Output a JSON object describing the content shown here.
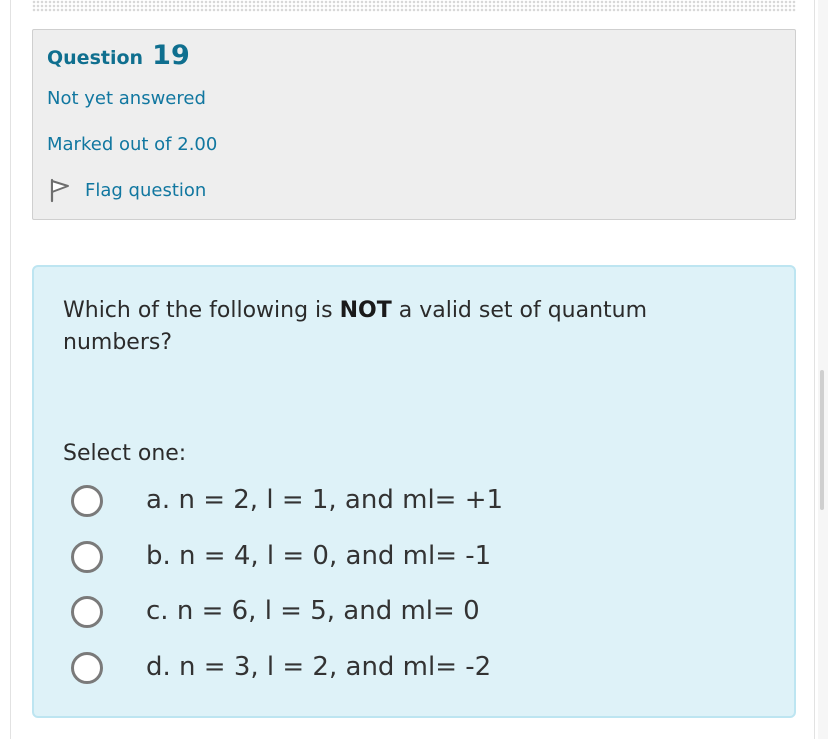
{
  "info": {
    "question_label": "Question",
    "question_number": "19",
    "state": "Not yet answered",
    "grade": "Marked out of 2.00",
    "flag_label": "Flag question",
    "flag_icon": "flag-icon"
  },
  "question": {
    "text_before": "Which of the following is ",
    "text_bold": "NOT",
    "text_after": " a valid set of quantum numbers?",
    "prompt": "Select one:",
    "options": [
      {
        "label": "a. n = 2, l = 1, and ml= +1"
      },
      {
        "label": "b. n = 4, l = 0, and ml= -1"
      },
      {
        "label": "c. n = 6, l = 5, and ml= 0"
      },
      {
        "label": "d. n = 3, l = 2, and ml= -2"
      }
    ]
  },
  "colors": {
    "link": "#1177a0",
    "heading": "#0f6f8f",
    "info_bg": "#eeeeee",
    "question_bg": "#def2f8",
    "question_border": "#bde5f1"
  }
}
